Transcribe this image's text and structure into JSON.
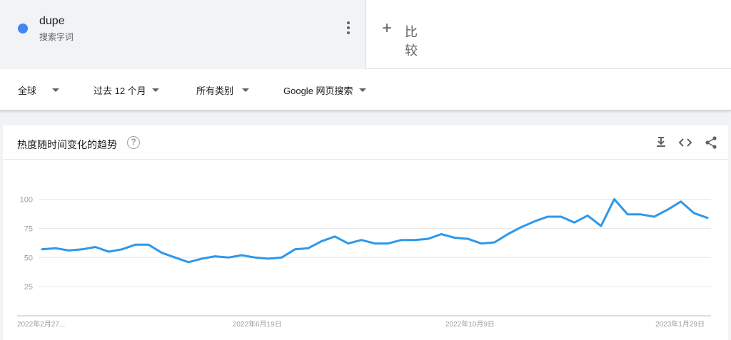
{
  "term": {
    "name": "dupe",
    "type_label": "搜索字词",
    "color": "#4285f4"
  },
  "compare": {
    "plus": "+",
    "label": "比较"
  },
  "filters": [
    {
      "label": "全球"
    },
    {
      "label": "过去 12 个月"
    },
    {
      "label": "所有类别"
    },
    {
      "label": "Google 网页搜索"
    }
  ],
  "panel": {
    "title": "热度随时间变化的趋势",
    "help_glyph": "?",
    "actions": [
      "download-icon",
      "embed-icon",
      "share-icon"
    ]
  },
  "chart_data": {
    "type": "line",
    "ylim": [
      0,
      100
    ],
    "yticks": [
      25,
      50,
      75,
      100
    ],
    "grid": true,
    "line_color": "#2e98ea",
    "xtick_labels": [
      {
        "index": 0,
        "label": "2022年2月27..."
      },
      {
        "index": 16,
        "label": "2022年6月19日"
      },
      {
        "index": 32,
        "label": "2022年10月9日"
      },
      {
        "index": 48,
        "label": "2023年1月29日"
      }
    ],
    "series": [
      {
        "values": [
          57,
          58,
          56,
          57,
          59,
          55,
          57,
          61,
          61,
          54,
          50,
          46,
          49,
          51,
          50,
          52,
          50,
          49,
          50,
          57,
          58,
          64,
          68,
          62,
          65,
          62,
          62,
          65,
          65,
          66,
          70,
          67,
          66,
          62,
          63,
          70,
          76,
          81,
          85,
          85,
          80,
          86,
          77,
          100,
          87,
          87,
          85,
          91,
          98,
          88,
          84
        ]
      }
    ]
  }
}
